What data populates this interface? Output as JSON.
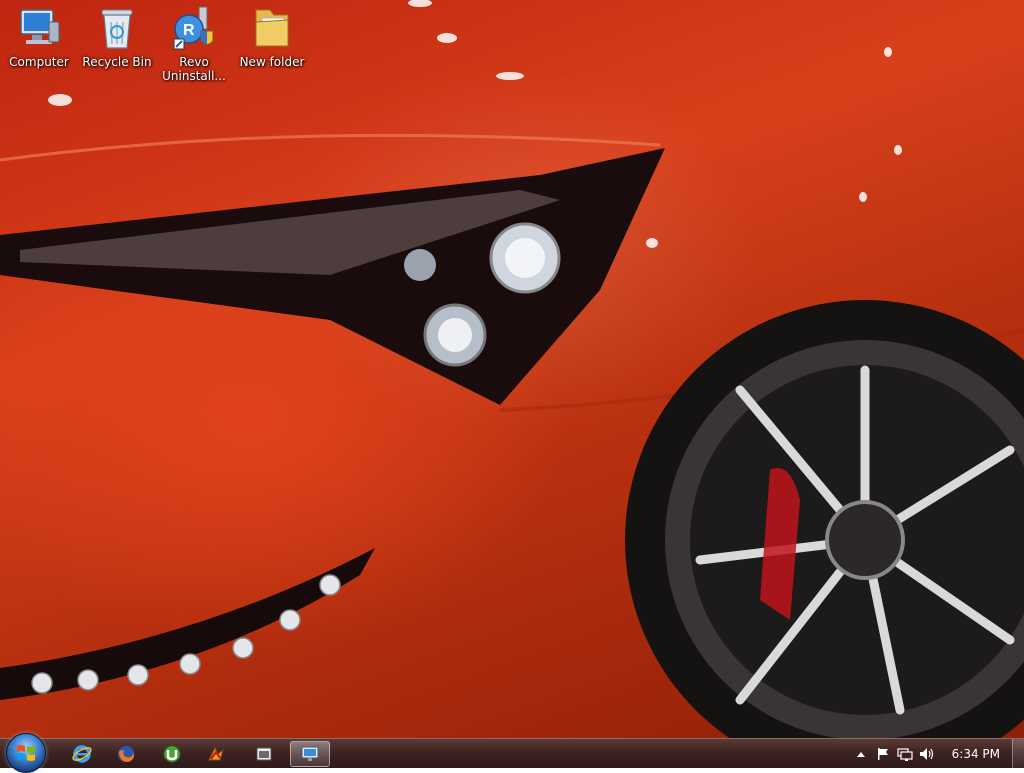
{
  "desktop": {
    "icons": [
      {
        "label": "Computer",
        "icon": "computer-icon"
      },
      {
        "label": "Recycle Bin",
        "icon": "recycle-bin-icon"
      },
      {
        "label": "Revo Uninstall...",
        "icon": "revo-uninstaller-icon"
      },
      {
        "label": "New folder",
        "icon": "folder-icon"
      }
    ]
  },
  "taskbar": {
    "pinned": [
      {
        "icon": "internet-explorer-icon"
      },
      {
        "icon": "firefox-icon"
      },
      {
        "icon": "utorrent-icon"
      },
      {
        "icon": "winamp-icon"
      },
      {
        "icon": "media-center-icon"
      },
      {
        "icon": "remote-desktop-icon",
        "active": true
      }
    ],
    "tray": {
      "icons": [
        "show-hidden-icons-icon",
        "action-center-flag-icon",
        "network-icon",
        "volume-icon"
      ],
      "clock": "6:34 PM"
    }
  },
  "colors": {
    "wallpaper_red": "#c0250f",
    "taskbar": "#3f2422"
  }
}
